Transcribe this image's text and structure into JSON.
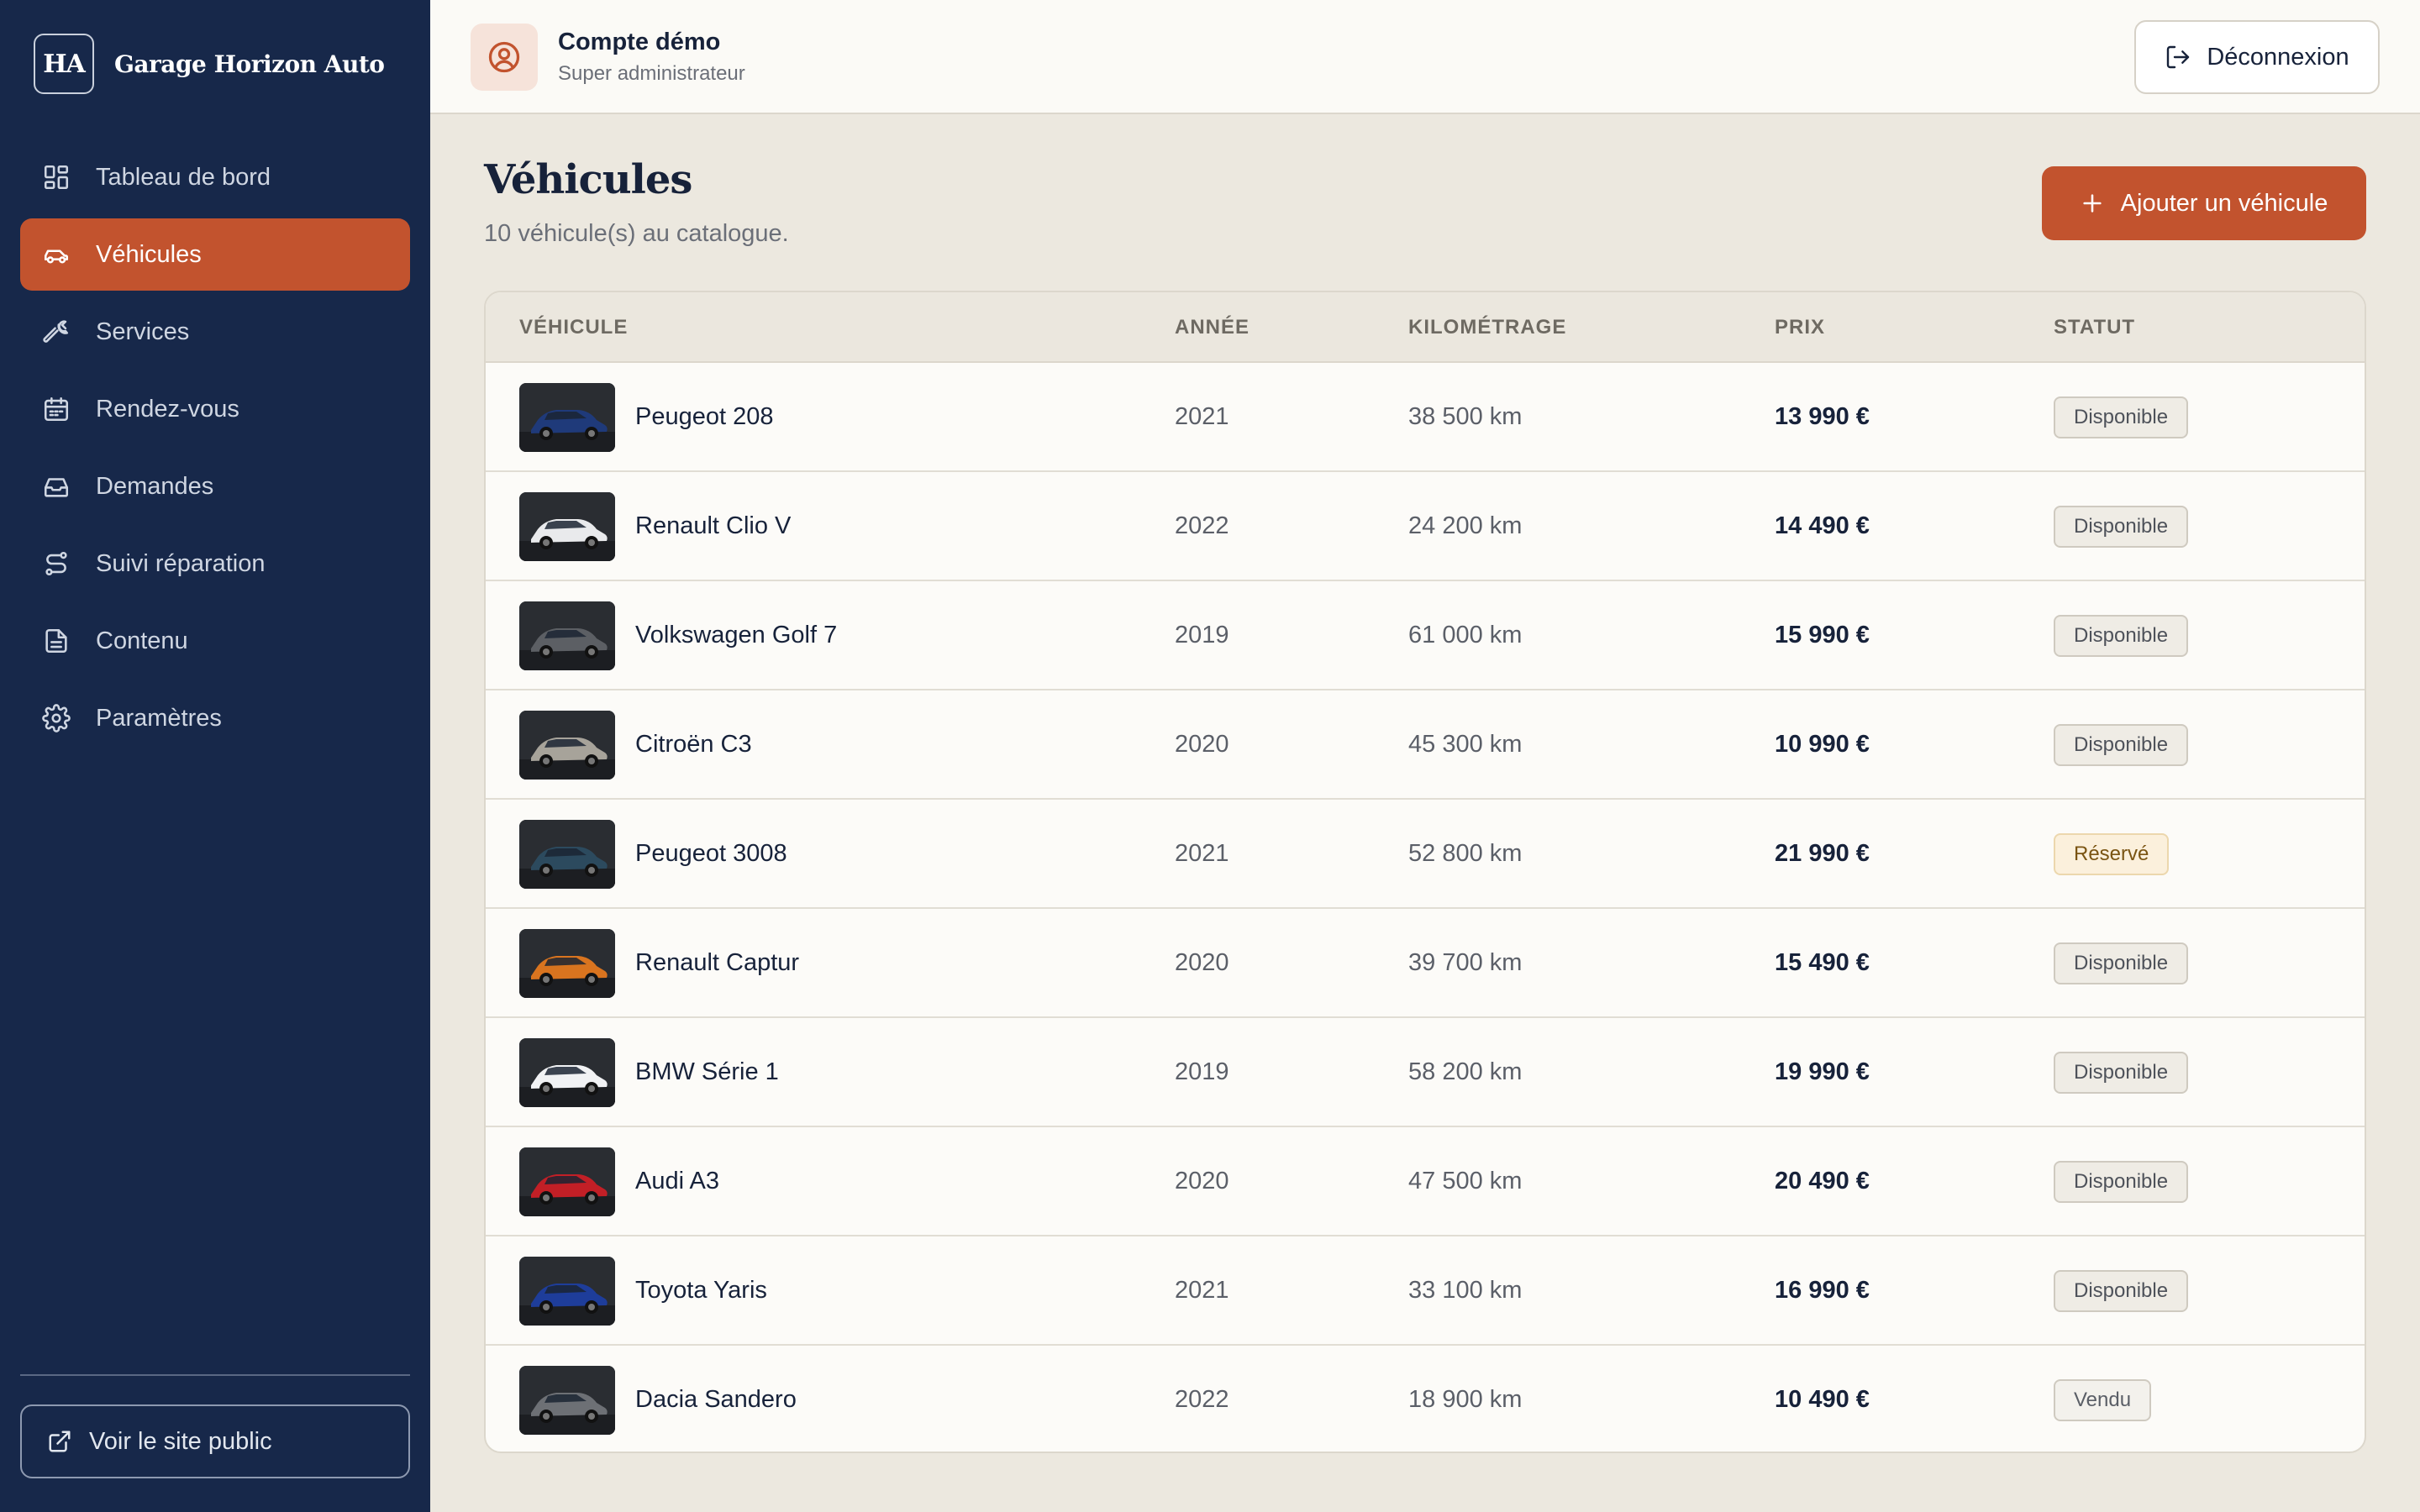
{
  "brand": {
    "logo_text": "HA",
    "name": "Garage Horizon Auto"
  },
  "sidebar": {
    "items": [
      {
        "label": "Tableau de bord",
        "icon": "dashboard-icon",
        "active": false
      },
      {
        "label": "Véhicules",
        "icon": "car-icon",
        "active": true
      },
      {
        "label": "Services",
        "icon": "wrench-icon",
        "active": false
      },
      {
        "label": "Rendez-vous",
        "icon": "calendar-icon",
        "active": false
      },
      {
        "label": "Demandes",
        "icon": "inbox-icon",
        "active": false
      },
      {
        "label": "Suivi réparation",
        "icon": "route-icon",
        "active": false
      },
      {
        "label": "Contenu",
        "icon": "document-icon",
        "active": false
      },
      {
        "label": "Paramètres",
        "icon": "gear-icon",
        "active": false
      }
    ],
    "public_site_label": "Voir le site public"
  },
  "header": {
    "account_name": "Compte démo",
    "account_role": "Super administrateur",
    "logout_label": "Déconnexion"
  },
  "main": {
    "title": "Véhicules",
    "subtitle": "10 véhicule(s) au catalogue.",
    "add_button_label": "Ajouter un véhicule",
    "columns": [
      "VÉHICULE",
      "ANNÉE",
      "KILOMÉTRAGE",
      "PRIX",
      "STATUT"
    ],
    "rows": [
      {
        "name": "Peugeot 208",
        "year": "2021",
        "km": "38 500 km",
        "price": "13 990 €",
        "status": "Disponible",
        "car_color": "#1f3a7a"
      },
      {
        "name": "Renault Clio V",
        "year": "2022",
        "km": "24 200 km",
        "price": "14 490 €",
        "status": "Disponible",
        "car_color": "#e9eaec"
      },
      {
        "name": "Volkswagen Golf 7",
        "year": "2019",
        "km": "61 000 km",
        "price": "15 990 €",
        "status": "Disponible",
        "car_color": "#5c5f64"
      },
      {
        "name": "Citroën C3",
        "year": "2020",
        "km": "45 300 km",
        "price": "10 990 €",
        "status": "Disponible",
        "car_color": "#a7a39a"
      },
      {
        "name": "Peugeot 3008",
        "year": "2021",
        "km": "52 800 km",
        "price": "21 990 €",
        "status": "Réservé",
        "car_color": "#2c4a5e"
      },
      {
        "name": "Renault Captur",
        "year": "2020",
        "km": "39 700 km",
        "price": "15 490 €",
        "status": "Disponible",
        "car_color": "#d9741f"
      },
      {
        "name": "BMW Série 1",
        "year": "2019",
        "km": "58 200 km",
        "price": "19 990 €",
        "status": "Disponible",
        "car_color": "#f1f2f4"
      },
      {
        "name": "Audi A3",
        "year": "2020",
        "km": "47 500 km",
        "price": "20 490 €",
        "status": "Disponible",
        "car_color": "#c21f26"
      },
      {
        "name": "Toyota Yaris",
        "year": "2021",
        "km": "33 100 km",
        "price": "16 990 €",
        "status": "Disponible",
        "car_color": "#1e3d9a"
      },
      {
        "name": "Dacia Sandero",
        "year": "2022",
        "km": "18 900 km",
        "price": "10 490 €",
        "status": "Vendu",
        "car_color": "#6d7075"
      }
    ]
  },
  "colors": {
    "sidebar_bg": "#17284a",
    "accent": "#c2532e",
    "page_bg": "#ece8df"
  }
}
